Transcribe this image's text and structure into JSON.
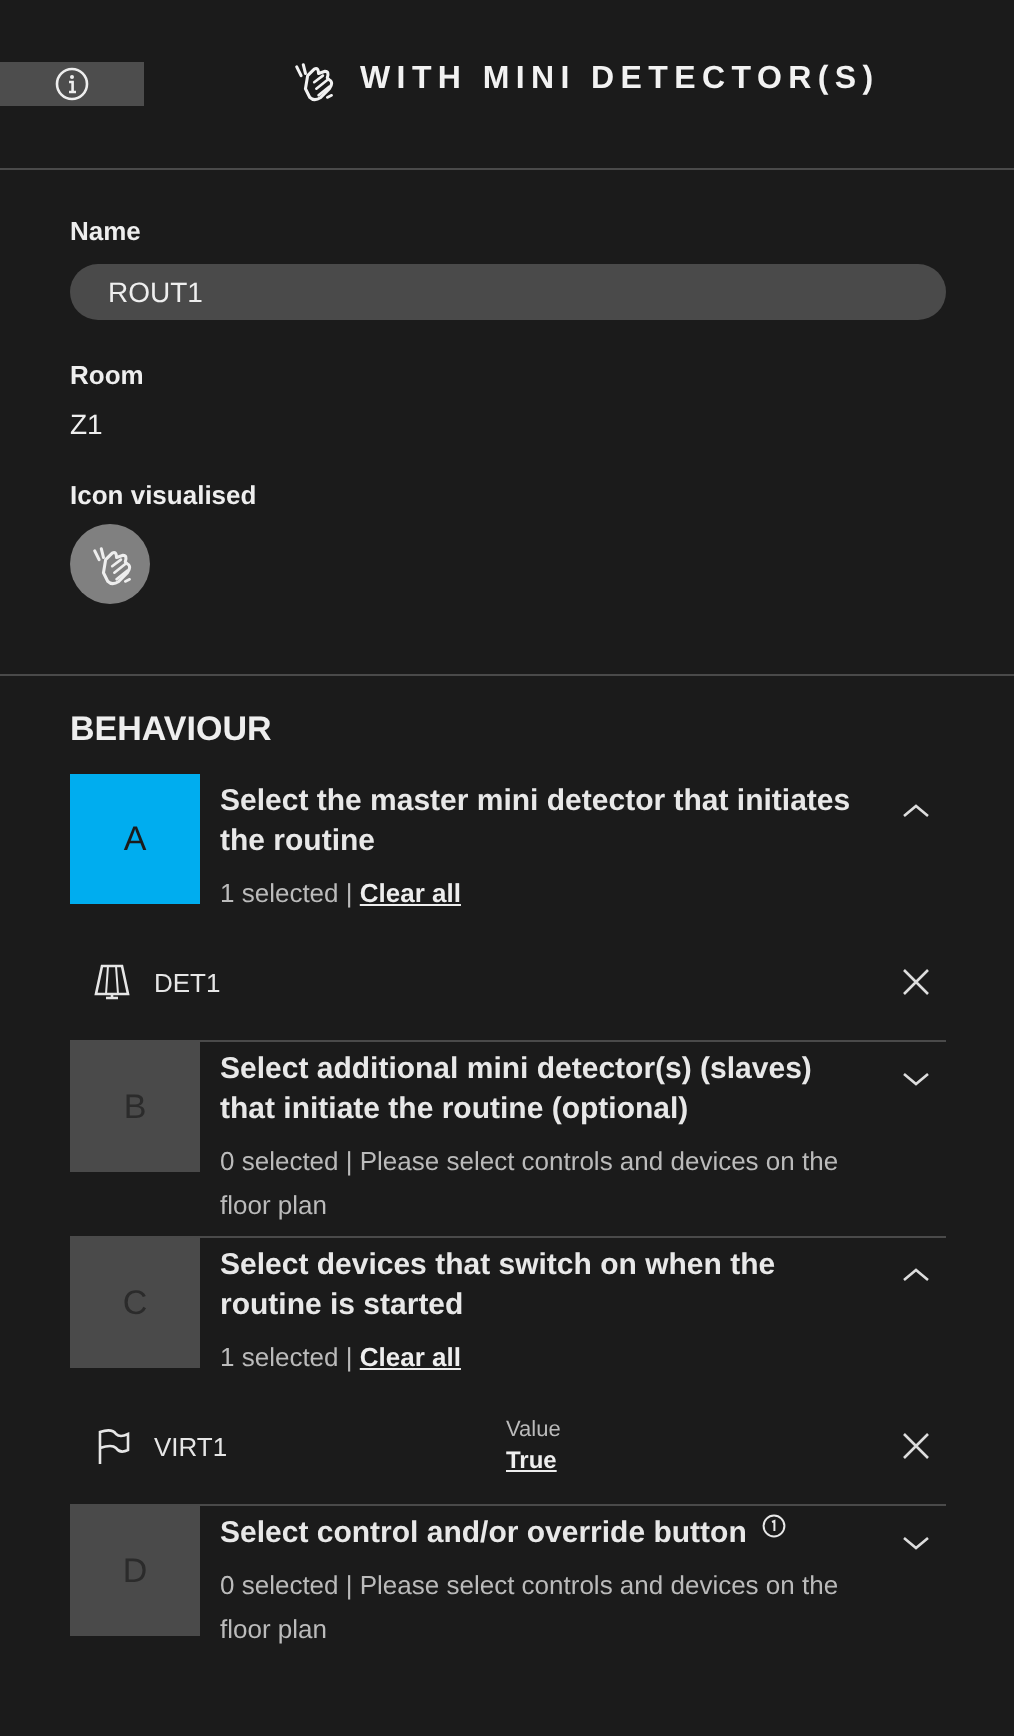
{
  "header": {
    "title": "WITH MINI DETECTOR(S)"
  },
  "fields": [
    {
      "kind": "input",
      "label": "Name",
      "value": "ROUT1"
    },
    {
      "kind": "text",
      "label": "Room",
      "value": "Z1"
    },
    {
      "kind": "icon",
      "label": "Icon visualised"
    }
  ],
  "behaviour": {
    "title": "BEHAVIOUR",
    "steps": [
      {
        "letter": "A",
        "title": "Select the master mini detector that initiates the routine",
        "selected": true,
        "expanded": true,
        "info": false,
        "summary": "1 selected |",
        "link": "Clear all",
        "items": [
          {
            "kind": "detector",
            "name": "DET1"
          }
        ]
      },
      {
        "letter": "B",
        "title": "Select additional mini detector(s) (slaves) that initiate the routine (optional)",
        "selected": false,
        "expanded": false,
        "info": false,
        "summary": "0 selected | Please select controls and devices on the floor plan"
      },
      {
        "letter": "C",
        "title": "Select devices that switch on when the routine is started",
        "selected": false,
        "expanded": true,
        "info": false,
        "summary": "1 selected |",
        "link": "Clear all",
        "items": [
          {
            "kind": "virtual",
            "name": "VIRT1",
            "value_label": "Value",
            "value": "True"
          }
        ]
      },
      {
        "letter": "D",
        "title": "Select control and/or override button",
        "selected": false,
        "expanded": false,
        "info": true,
        "summary": "0 selected | Please select controls and devices on the floor plan"
      }
    ]
  }
}
